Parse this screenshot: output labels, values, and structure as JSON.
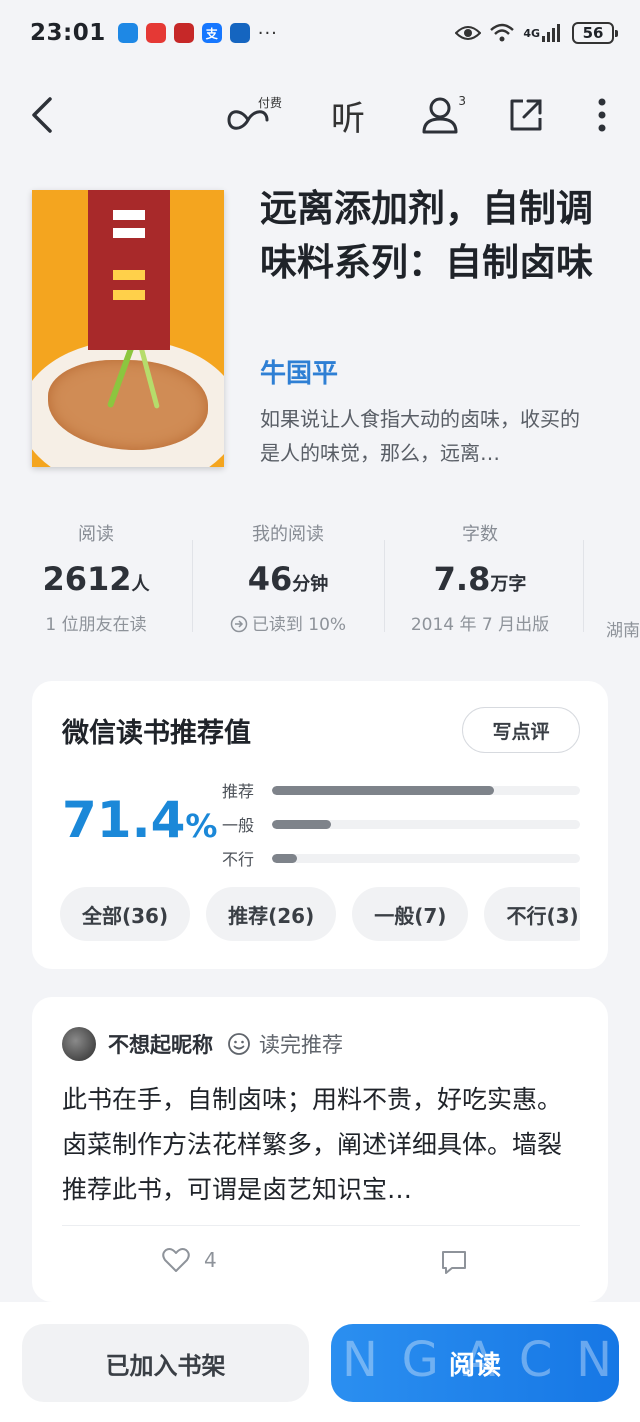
{
  "status_bar": {
    "time": "23:01",
    "dots": "···",
    "network": "4G",
    "battery": "56",
    "apps": [
      {
        "icon": "chat-app-icon",
        "color": "#1e88e5",
        "glyph": ""
      },
      {
        "icon": "weibo-icon",
        "color": "#e53935",
        "glyph": ""
      },
      {
        "icon": "book-app-icon",
        "color": "#c62828",
        "glyph": ""
      },
      {
        "icon": "alipay-icon",
        "color": "#1677ff",
        "glyph": "支"
      },
      {
        "icon": "compass-app-icon",
        "color": "#1565c0",
        "glyph": ""
      }
    ]
  },
  "toolbar": {
    "back": "back-icon",
    "paid_label": "付费",
    "listen_label": "听",
    "friends_count": "3"
  },
  "book": {
    "title": "远离添加剂，自制调味料系列：自制卤味",
    "author": "牛国平",
    "description": "如果说让人食指大动的卤味，收买的是人的味觉，那么，远离…"
  },
  "stats": [
    {
      "label": "阅读",
      "value": "2612",
      "unit": "人",
      "sub": "1 位朋友在读"
    },
    {
      "label": "我的阅读",
      "value": "46",
      "unit": "分钟",
      "sub": "已读到 10%"
    },
    {
      "label": "字数",
      "value": "7.8",
      "unit": "万字",
      "sub": "2014 年 7 月出版"
    },
    {
      "label": "",
      "value": "",
      "unit": "",
      "sub": "湖南"
    }
  ],
  "rating": {
    "title": "微信读书推荐值",
    "write_label": "写点评",
    "score": "71.4",
    "percent_sign": "%",
    "bars": [
      {
        "label": "推荐",
        "fraction": 0.72
      },
      {
        "label": "一般",
        "fraction": 0.19
      },
      {
        "label": "不行",
        "fraction": 0.08
      }
    ],
    "chips": [
      "全部(36)",
      "推荐(26)",
      "一般(7)",
      "不行(3)"
    ]
  },
  "review": {
    "user": "不想起昵称",
    "badge": "读完推荐",
    "text": "此书在手，自制卤味；用料不贵，好吃实惠。卤菜制作方法花样繁多，阐述详细具体。墙裂推荐此书，可谓是卤艺知识宝…",
    "likes": "4"
  },
  "bottom": {
    "shelf_label": "已加入书架",
    "read_label": "阅读",
    "watermark": [
      "N",
      "G",
      "A",
      "C",
      "N"
    ]
  }
}
